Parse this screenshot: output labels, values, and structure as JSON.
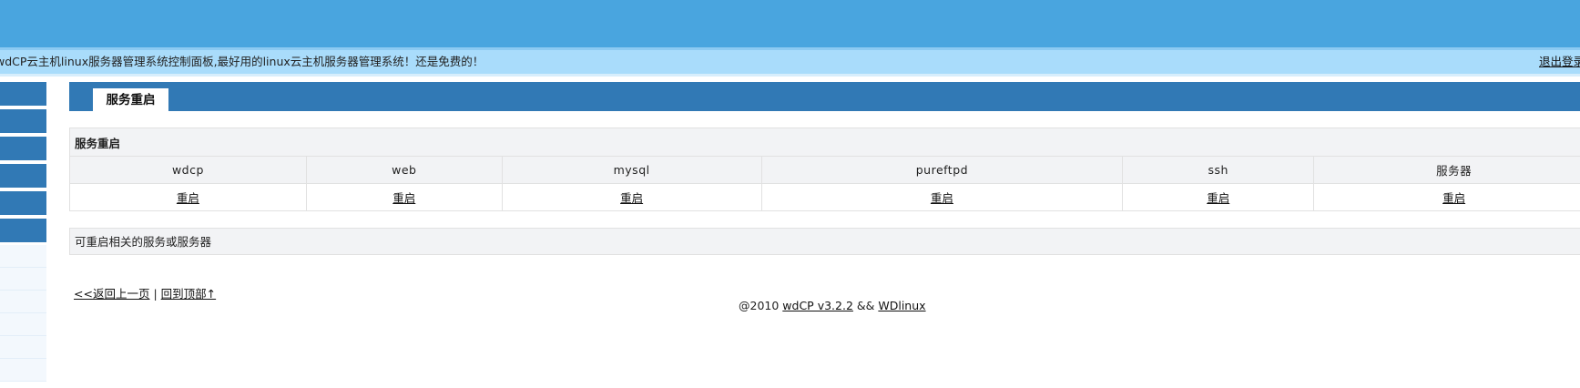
{
  "header": {
    "notice": "wdCP云主机linux服务器管理系统控制面板,最好用的linux云主机服务器管理系统！还是免费的！",
    "logout_label": "退出登录"
  },
  "tab": {
    "label": "服务重启"
  },
  "services_table": {
    "caption": "服务重启",
    "columns": [
      "wdcp",
      "web",
      "mysql",
      "pureftpd",
      "ssh",
      "服务器"
    ],
    "action_label": "重启"
  },
  "hint": "可重启相关的服务或服务器",
  "nav": {
    "back_label": "<<返回上一页",
    "separator": "|",
    "top_label": "回到顶部↑"
  },
  "footer": {
    "prefix": "@2010",
    "product_link": "wdCP v3.2.2",
    "joiner": "&&",
    "author_link": "WDlinux"
  },
  "colors": {
    "header_blue": "#49a5df",
    "notice_bg": "#a9dcfb",
    "nav_blue": "#3179b5",
    "table_head_bg": "#f2f3f5"
  }
}
